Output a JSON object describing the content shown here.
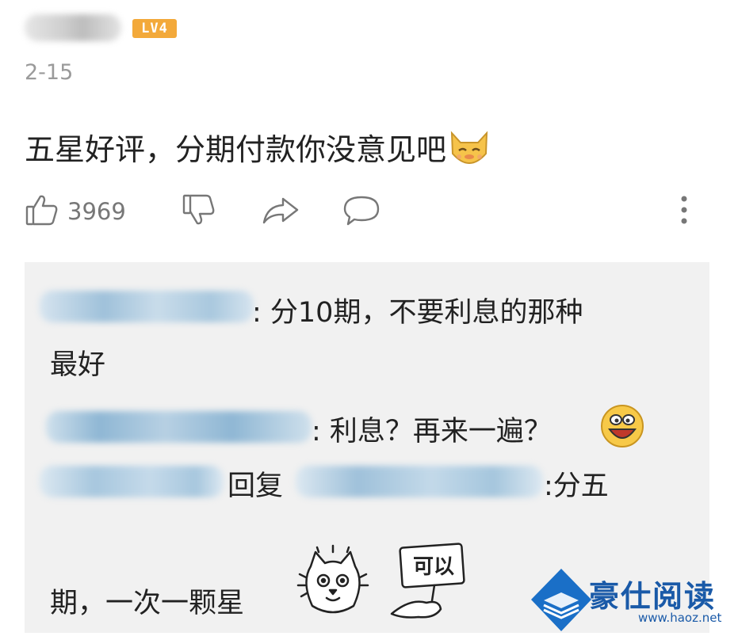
{
  "user": {
    "level": "LV4",
    "date": "2-15"
  },
  "comment": {
    "text": "五星好评，分期付款你没意见吧",
    "emoji": "cat-face-emoji"
  },
  "actions": {
    "like_count": "3969",
    "icons": [
      "thumbs-up-icon",
      "thumbs-down-icon",
      "share-icon",
      "comment-icon",
      "more-icon"
    ]
  },
  "replies": {
    "r1_text": ": 分10期，不要利息的那种",
    "r1_cont": "最好",
    "r2_text": ": 利息？再来一遍？",
    "r3_reply_word": "回复",
    "r3_text": ":分五",
    "r4_text": "期，一次一颗星",
    "sticker_sign": "可以"
  },
  "watermark": {
    "title": "豪仕阅读",
    "url": "www.haoz.net"
  },
  "colors": {
    "level_badge": "#f3a93a",
    "reply_bg": "#f1f1f1",
    "watermark_blue": "#1a5aa8"
  }
}
